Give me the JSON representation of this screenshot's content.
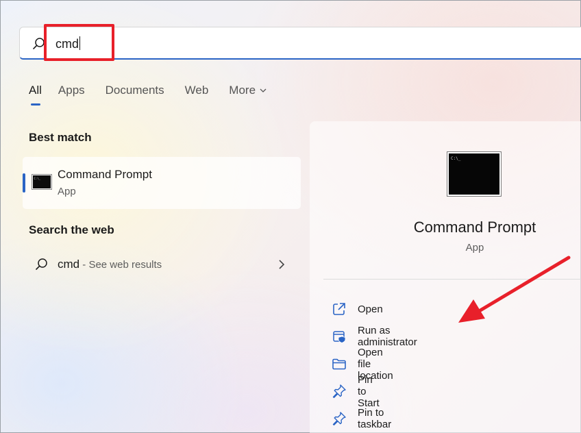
{
  "search": {
    "query": "cmd"
  },
  "tabs": [
    {
      "label": "All",
      "active": true
    },
    {
      "label": "Apps"
    },
    {
      "label": "Documents"
    },
    {
      "label": "Web"
    },
    {
      "label": "More"
    }
  ],
  "best_match": {
    "title": "Best match",
    "item": {
      "name": "Command Prompt",
      "type": "App",
      "icon": "cmd-app-icon"
    }
  },
  "search_web": {
    "title": "Search the web",
    "query": "cmd",
    "suffix": " - See web results"
  },
  "detail": {
    "name": "Command Prompt",
    "type": "App",
    "actions": [
      {
        "label": "Open",
        "icon": "open-external-icon"
      },
      {
        "label": "Run as administrator",
        "icon": "shield-admin-icon"
      },
      {
        "label": "Open file location",
        "icon": "folder-icon"
      },
      {
        "label": "Pin to Start",
        "icon": "pin-icon"
      },
      {
        "label": "Pin to taskbar",
        "icon": "pin-icon"
      }
    ]
  },
  "colors": {
    "accent": "#2a64c5",
    "annotation": "#e8202a"
  }
}
